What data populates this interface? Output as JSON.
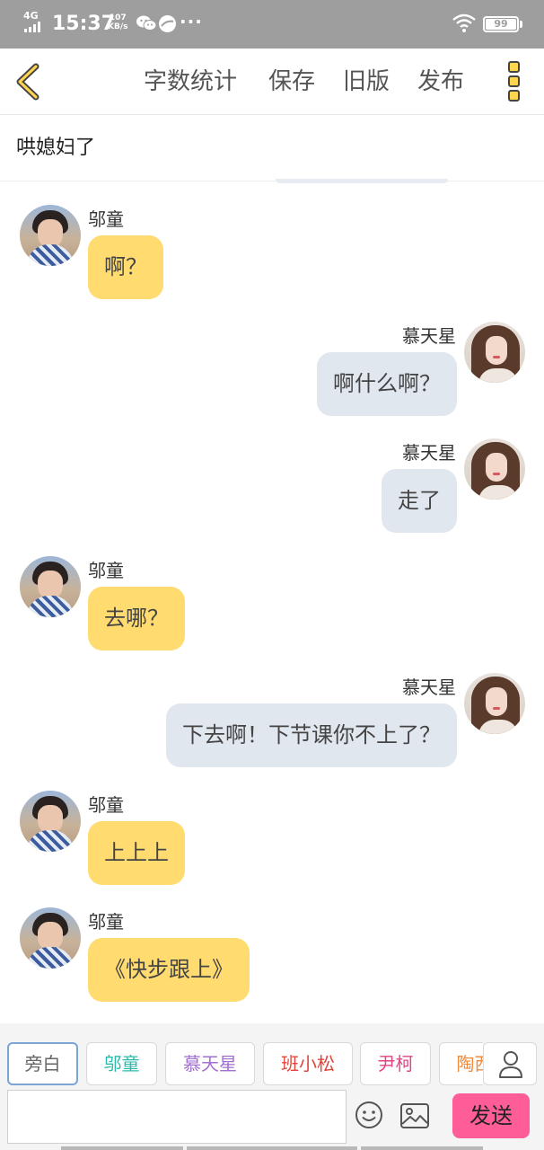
{
  "status_bar": {
    "network": "4G",
    "time": "15:37",
    "speed_value": "107",
    "speed_unit": "KB/s",
    "more": "···",
    "battery": "99"
  },
  "nav": {
    "actions": [
      "字数统计",
      "保存",
      "旧版",
      "发布"
    ]
  },
  "title": "哄媳妇了",
  "messages": [
    {
      "side": "left",
      "speaker": "邬童",
      "text": "啊？",
      "avatar": "boy"
    },
    {
      "side": "right",
      "speaker": "慕天星",
      "text": "啊什么啊？",
      "avatar": "girl"
    },
    {
      "side": "right",
      "speaker": "慕天星",
      "text": "走了",
      "avatar": "girl"
    },
    {
      "side": "left",
      "speaker": "邬童",
      "text": "去哪？",
      "avatar": "boy"
    },
    {
      "side": "right",
      "speaker": "慕天星",
      "text": "下去啊！下节课你不上了？",
      "avatar": "girl"
    },
    {
      "side": "left",
      "speaker": "邬童",
      "text": "上上上",
      "avatar": "boy"
    },
    {
      "side": "left",
      "speaker": "邬童",
      "text": "《快步跟上》",
      "avatar": "boy"
    }
  ],
  "characters": [
    {
      "label": "旁白",
      "color": "#666666",
      "selected": true
    },
    {
      "label": "邬童",
      "color": "#2bbbad",
      "selected": false
    },
    {
      "label": "慕天星",
      "color": "#a36fd0",
      "selected": false
    },
    {
      "label": "班小松",
      "color": "#e0453d",
      "selected": false
    },
    {
      "label": "尹柯",
      "color": "#e04584",
      "selected": false
    },
    {
      "label": "陶西",
      "color": "#f08a3c",
      "selected": false
    }
  ],
  "composer": {
    "placeholder": "",
    "send_label": "发送"
  },
  "colors": {
    "accent": "#ffd54f",
    "left_bubble": "#ffdb70",
    "right_bubble": "#e1e7ef",
    "send_button": "#ff5d97"
  }
}
